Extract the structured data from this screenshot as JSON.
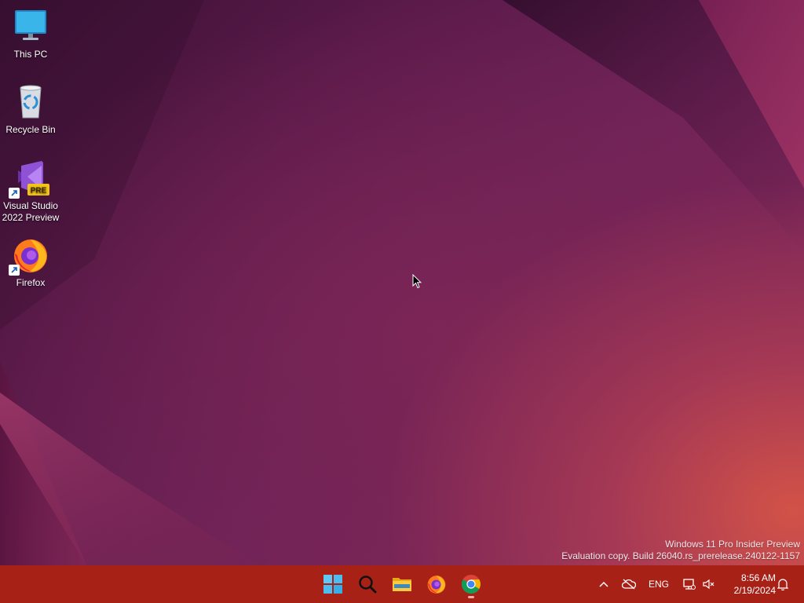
{
  "desktop": {
    "icons": [
      {
        "label": "This PC",
        "icon": "monitor-icon"
      },
      {
        "label": "Recycle Bin",
        "icon": "recycle-bin-icon"
      },
      {
        "label": "Visual Studio 2022 Preview",
        "icon": "visual-studio-icon",
        "badge": "PRE",
        "shortcut": true
      },
      {
        "label": "Firefox",
        "icon": "firefox-icon",
        "shortcut": true
      }
    ],
    "watermark": {
      "line1": "Windows 11 Pro Insider Preview",
      "line2": "Evaluation copy. Build 26040.rs_prerelease.240122-1157"
    }
  },
  "taskbar": {
    "background": "#a82117",
    "apps": [
      {
        "name": "start",
        "icon": "windows-logo-icon"
      },
      {
        "name": "search",
        "icon": "search-icon"
      },
      {
        "name": "file-explorer",
        "icon": "folder-icon"
      },
      {
        "name": "firefox",
        "icon": "firefox-icon"
      },
      {
        "name": "chrome",
        "icon": "chrome-icon",
        "running": true
      }
    ],
    "tray": {
      "overflow_icon": "chevron-up-icon",
      "onedrive_icon": "cloud-offline-icon",
      "language": "ENG",
      "network_icon": "network-icon",
      "volume_icon": "volume-muted-icon",
      "time": "8:56 AM",
      "date": "2/19/2024",
      "notification_icon": "bell-icon"
    }
  }
}
